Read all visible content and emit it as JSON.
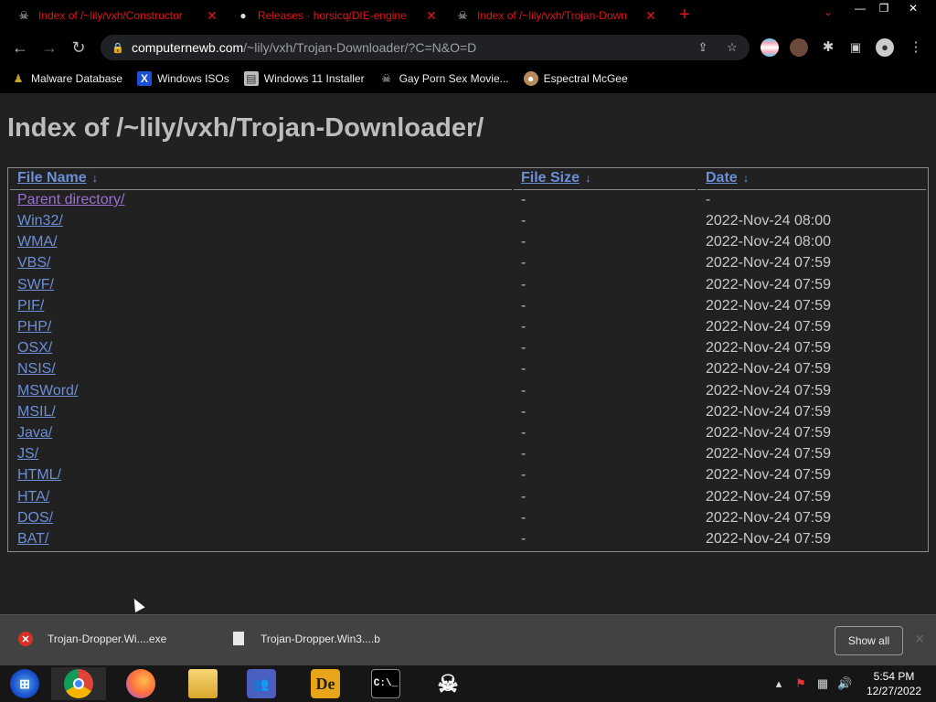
{
  "browser": {
    "tabs": [
      {
        "title": "Index of /~lily/vxh/Constructor",
        "icon": "skull-icon"
      },
      {
        "title": "Releases · horsicq/DIE-engine",
        "icon": "github-icon"
      },
      {
        "title": "Index of /~lily/vxh/Trojan-Down",
        "icon": "skull-icon",
        "active": true
      }
    ],
    "new_tab": "+",
    "tab_search": "⌄",
    "window_controls": {
      "minimize": "—",
      "maximize": "❐",
      "close": "✕"
    },
    "nav": {
      "back": "←",
      "forward": "→",
      "reload": "↻"
    },
    "address": {
      "host": "computernewb.com",
      "path": "/~lily/vxh/Trojan-Downloader/?C=N&O=D"
    },
    "bookmarks": [
      {
        "label": "Malware Database",
        "icon": "person-icon",
        "color": "#c9a227"
      },
      {
        "label": "Windows ISOs",
        "icon": "x-icon",
        "color": "#1c4fd1"
      },
      {
        "label": "Windows 11 Installer",
        "icon": "image-icon",
        "color": "#bbbbbb"
      },
      {
        "label": "Gay Porn Sex Movie...",
        "icon": "skull-icon",
        "color": "#dddddd"
      },
      {
        "label": "Espectral McGee",
        "icon": "avatar-icon",
        "color": "#b78a5a"
      }
    ]
  },
  "page": {
    "title": "Index of /~lily/vxh/Trojan-Downloader/",
    "columns": {
      "name": "File Name",
      "size": "File Size",
      "date": "Date",
      "sort_arrow": "↓"
    },
    "parent": {
      "name": "Parent directory/",
      "size": "-",
      "date": "-"
    },
    "entries": [
      {
        "name": "Win32/",
        "size": "-",
        "date": "2022-Nov-24 08:00"
      },
      {
        "name": "WMA/",
        "size": "-",
        "date": "2022-Nov-24 08:00"
      },
      {
        "name": "VBS/",
        "size": "-",
        "date": "2022-Nov-24 07:59"
      },
      {
        "name": "SWF/",
        "size": "-",
        "date": "2022-Nov-24 07:59"
      },
      {
        "name": "PIF/",
        "size": "-",
        "date": "2022-Nov-24 07:59"
      },
      {
        "name": "PHP/",
        "size": "-",
        "date": "2022-Nov-24 07:59"
      },
      {
        "name": "OSX/",
        "size": "-",
        "date": "2022-Nov-24 07:59"
      },
      {
        "name": "NSIS/",
        "size": "-",
        "date": "2022-Nov-24 07:59"
      },
      {
        "name": "MSWord/",
        "size": "-",
        "date": "2022-Nov-24 07:59"
      },
      {
        "name": "MSIL/",
        "size": "-",
        "date": "2022-Nov-24 07:59"
      },
      {
        "name": "Java/",
        "size": "-",
        "date": "2022-Nov-24 07:59"
      },
      {
        "name": "JS/",
        "size": "-",
        "date": "2022-Nov-24 07:59"
      },
      {
        "name": "HTML/",
        "size": "-",
        "date": "2022-Nov-24 07:59"
      },
      {
        "name": "HTA/",
        "size": "-",
        "date": "2022-Nov-24 07:59"
      },
      {
        "name": "DOS/",
        "size": "-",
        "date": "2022-Nov-24 07:59"
      },
      {
        "name": "BAT/",
        "size": "-",
        "date": "2022-Nov-24 07:59"
      }
    ]
  },
  "downloads": {
    "items": [
      {
        "label": "Trojan-Dropper.Wi....exe",
        "status": "error-icon"
      },
      {
        "label": "Trojan-Dropper.Win3....b",
        "status": "file-icon"
      }
    ],
    "show_all": "Show all",
    "close": "✕"
  },
  "taskbar": {
    "apps": [
      {
        "name": "start-button",
        "icon": "windows-orb-icon"
      },
      {
        "name": "chrome",
        "icon": "chrome-icon",
        "active": true
      },
      {
        "name": "firefox",
        "icon": "firefox-icon"
      },
      {
        "name": "explorer",
        "icon": "folder-icon"
      },
      {
        "name": "messenger",
        "icon": "messenger-icon"
      },
      {
        "name": "de-app",
        "icon": "de-icon",
        "text": "De"
      },
      {
        "name": "cmd",
        "icon": "console-icon"
      },
      {
        "name": "skull-app",
        "icon": "skull-crossbones-icon"
      }
    ],
    "clock": {
      "time": "5:54 PM",
      "date": "12/27/2022"
    }
  },
  "colors": {
    "tab_text": "#e0151c",
    "link": "#6c8fd8",
    "link_visited": "#9b6fd3",
    "page_bg": "#212121"
  }
}
